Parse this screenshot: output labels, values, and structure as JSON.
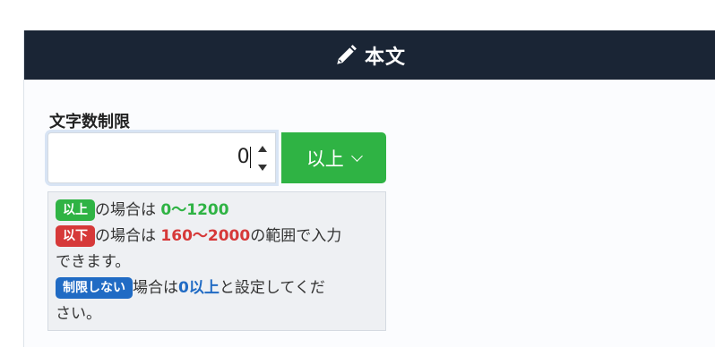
{
  "header": {
    "title": "本文",
    "icon": "pencil-icon"
  },
  "field": {
    "label": "文字数制限",
    "value": "0"
  },
  "dropdown": {
    "label": "以上",
    "icon": "chevron-down-icon"
  },
  "help": {
    "line1": {
      "badge": "以上",
      "text": "の場合は",
      "range": "0〜1200"
    },
    "line2": {
      "badge": "以下",
      "text": "の場合は",
      "range": "160〜2000",
      "suffix": "の範囲で入力",
      "cont": "できます。"
    },
    "line3": {
      "badge": "制限しない",
      "text": "場合は",
      "value": "0以上",
      "suffix": "と設定してくだ",
      "cont": "さい。"
    }
  },
  "colors": {
    "header_bg": "#1a2535",
    "green": "#2fb344",
    "red": "#d63939",
    "blue": "#206bc4"
  }
}
